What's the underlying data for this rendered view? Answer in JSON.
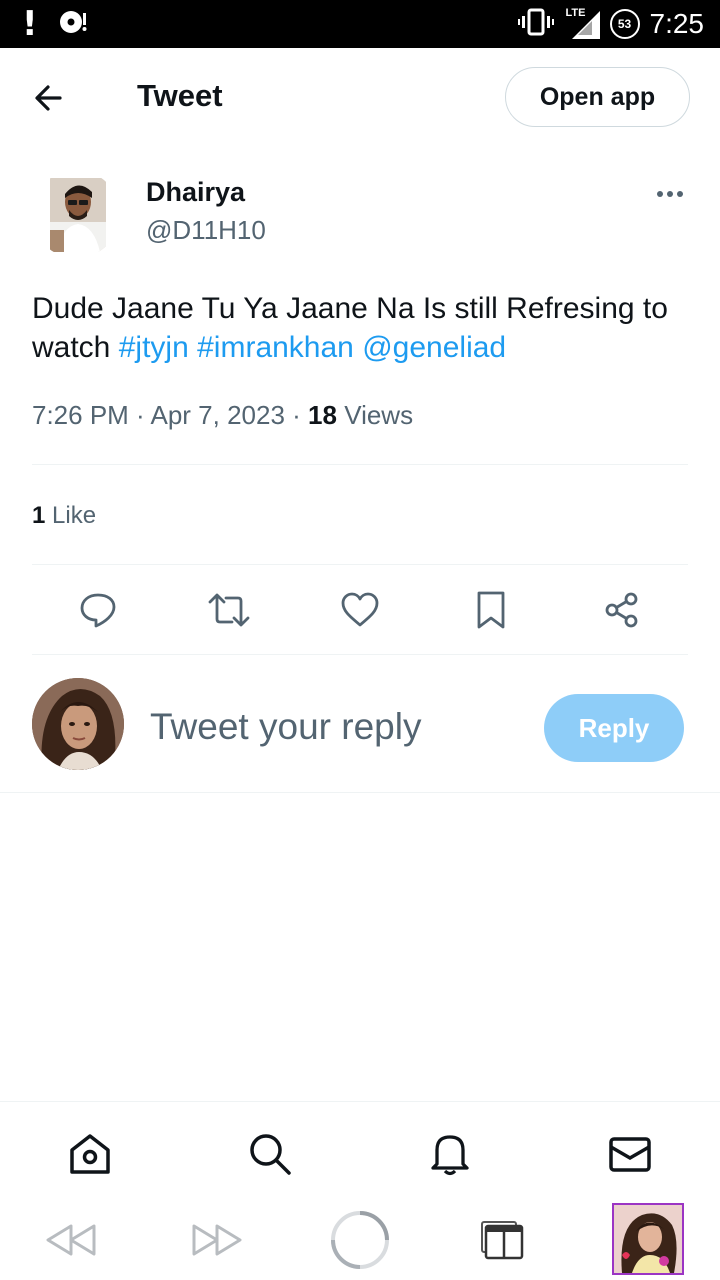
{
  "status_bar": {
    "time": "7:25",
    "network": "LTE",
    "battery": "53"
  },
  "header": {
    "title": "Tweet",
    "open_app_label": "Open app"
  },
  "tweet": {
    "author_name": "Dhairya",
    "author_handle": "@D11H10",
    "text_plain": "Dude Jaane Tu Ya Jaane Na Is still Refresing to watch ",
    "hashtag_1": "#jtyjn",
    "hashtag_2": "#imrankhan",
    "mention_1": "@geneliad",
    "time": "7:26 PM",
    "date": "Apr 7, 2023",
    "view_count": "18",
    "views_label": "Views",
    "like_count": "1",
    "like_label": "Like"
  },
  "actions": [
    "reply-icon",
    "retweet-icon",
    "like-icon",
    "bookmark-icon",
    "share-icon"
  ],
  "composer": {
    "placeholder": "Tweet your reply",
    "reply_label": "Reply"
  },
  "bottom_nav": [
    "home-icon",
    "search-icon",
    "notifications-icon",
    "messages-icon"
  ],
  "browser_bar": [
    "rewind-icon",
    "fast-forward-icon",
    "loading-icon",
    "tabs-icon",
    "tab-thumbnail"
  ],
  "colors": {
    "link": "#1d9bf0",
    "reply_button": "#8ecdf8",
    "secondary_text": "#536471",
    "primary_text": "#0f1419",
    "thumbnail_border": "#9b35c4"
  }
}
